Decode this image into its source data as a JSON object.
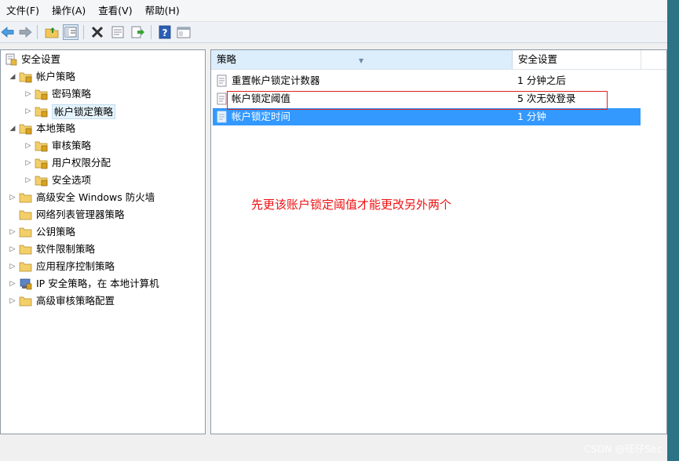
{
  "menubar": {
    "items": [
      "文件(F)",
      "操作(A)",
      "查看(V)",
      "帮助(H)"
    ]
  },
  "toolbar": {
    "buttons": [
      "back-arrow-icon",
      "forward-arrow-icon",
      "up-folder-icon",
      "show-hide-tree-icon",
      "delete-icon",
      "properties-icon",
      "export-icon",
      "help-icon",
      "console-icon"
    ]
  },
  "tree": {
    "root": "安全设置",
    "account_policies": "帐户策略",
    "password_policy": "密码策略",
    "lockout_policy": "帐户锁定策略",
    "local_policies": "本地策略",
    "audit_policy": "审核策略",
    "user_rights": "用户权限分配",
    "security_options": "安全选项",
    "firewall": "高级安全 Windows 防火墙",
    "netlist": "网络列表管理器策略",
    "public_key": "公钥策略",
    "software_restriction": "软件限制策略",
    "app_control": "应用程序控制策略",
    "ipsec": "IP 安全策略，在 本地计算机",
    "adv_audit": "高级审核策略配置"
  },
  "list": {
    "headers": [
      "策略",
      "安全设置"
    ],
    "rows": [
      {
        "policy": "重置帐户锁定计数器",
        "setting": "1 分钟之后"
      },
      {
        "policy": "帐户锁定阈值",
        "setting": "5 次无效登录"
      },
      {
        "policy": "帐户锁定时间",
        "setting": "1 分钟"
      }
    ]
  },
  "annotation": "先更该账户锁定阈值才能更改另外两个",
  "watermark": "CSDN @旺仔Sec",
  "colors": {
    "selection": "#3399ff",
    "highlight_box": "#e02020",
    "annotation": "#ee1111"
  }
}
